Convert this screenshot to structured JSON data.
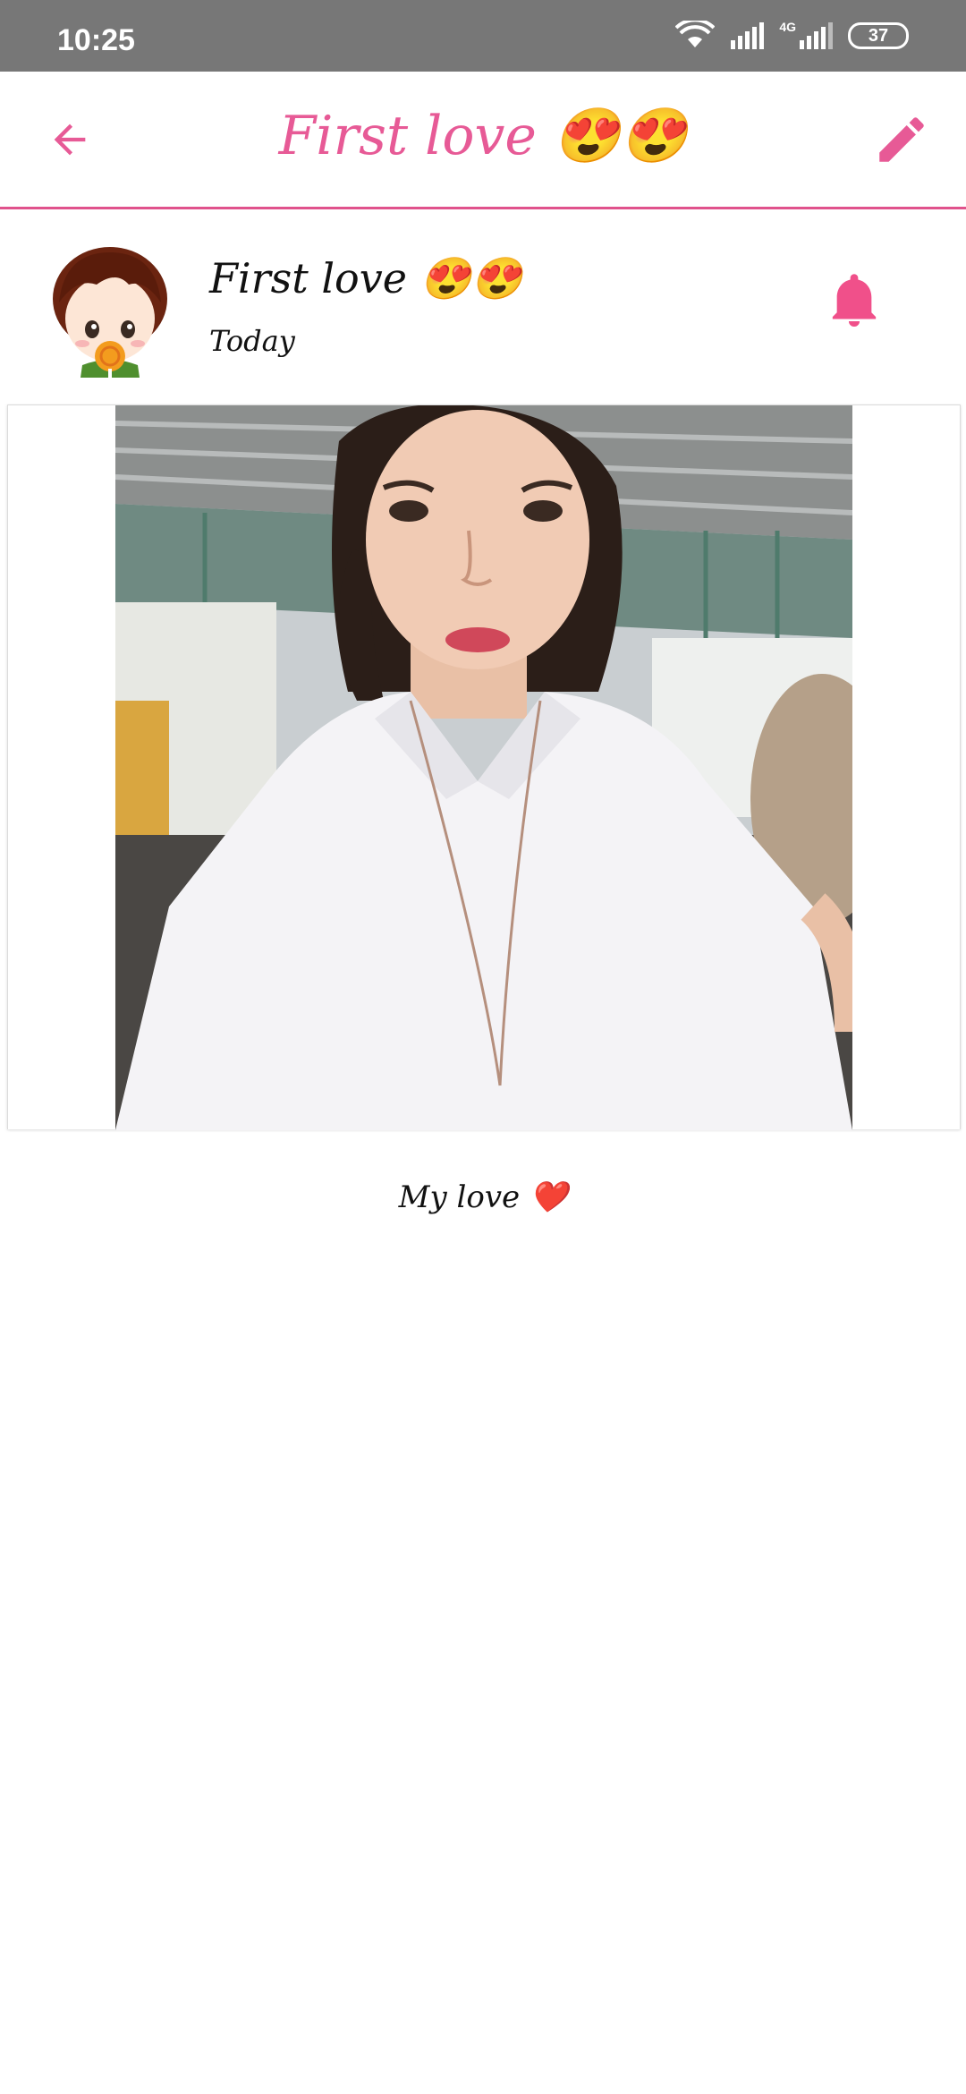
{
  "status_bar": {
    "time": "10:25",
    "network_label": "4G",
    "battery_level": "37"
  },
  "app_bar": {
    "title": "First love 😍😍",
    "back_icon": "arrow-left-icon",
    "edit_icon": "pencil-icon",
    "accent_color": "#e75a96"
  },
  "profile": {
    "name": "First love 😍😍",
    "date": "Today",
    "avatar_icon": "cartoon-boy-avatar",
    "bell_icon": "bell-icon"
  },
  "post": {
    "caption": "My love ❤️"
  }
}
